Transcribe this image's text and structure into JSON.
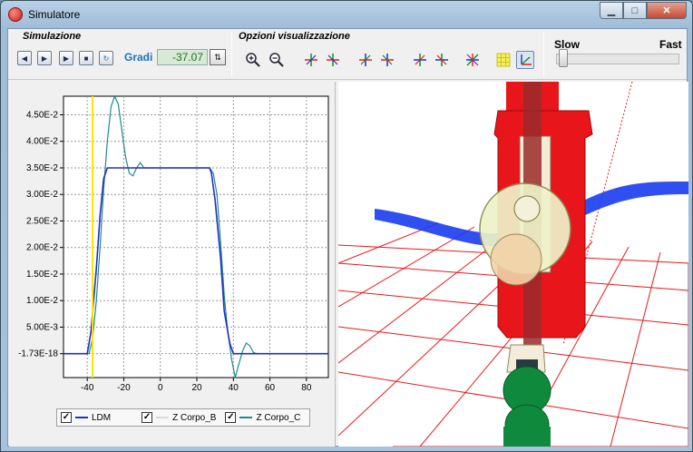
{
  "window": {
    "title": "Simulatore"
  },
  "toolbar": {
    "simulazione_label": "Simulazione",
    "opzioni_label": "Opzioni visualizzazione",
    "gradi_label": "Gradi",
    "gradi_value": "-37.07",
    "speed_slow": "Slow",
    "speed_fast": "Fast",
    "speed_value": 0.02
  },
  "chart_data": {
    "type": "line",
    "y_ticks": [
      "4.50E-2",
      "4.00E-2",
      "3.50E-2",
      "3.00E-2",
      "2.50E-2",
      "2.00E-2",
      "1.50E-2",
      "1.00E-2",
      "5.00E-3",
      "-1.73E-18"
    ],
    "x_ticks": [
      "-40",
      "-20",
      "0",
      "20",
      "40",
      "60",
      "80"
    ],
    "xlim": [
      -53,
      92
    ],
    "ylim": [
      -0.0045,
      0.0485
    ],
    "cursor_x": -37.07,
    "series": [
      {
        "name": "LDM",
        "color": "#2030c0",
        "x": [
          -53,
          -40,
          -38,
          -35,
          -33,
          -31,
          -29,
          -28,
          27,
          28,
          30,
          33,
          35,
          38,
          40,
          92
        ],
        "y": [
          0,
          0,
          0.004,
          0.016,
          0.026,
          0.033,
          0.035,
          0.035,
          0.035,
          0.034,
          0.029,
          0.018,
          0.008,
          0.002,
          0,
          0
        ]
      },
      {
        "name": "Z Corpo_B",
        "color": "#e8e8e8",
        "x": [
          -53,
          -40,
          -38,
          -35,
          -33,
          -31,
          -29,
          -28,
          27,
          28,
          30,
          33,
          35,
          38,
          40,
          92
        ],
        "y": [
          0,
          0,
          0.004,
          0.016,
          0.026,
          0.033,
          0.035,
          0.035,
          0.035,
          0.034,
          0.029,
          0.018,
          0.008,
          0.002,
          0,
          0
        ]
      },
      {
        "name": "Z Corpo_C",
        "color": "#1f8a8a",
        "x": [
          -53,
          -39,
          -37,
          -35,
          -33,
          -31,
          -29,
          -27,
          -25,
          -23,
          -21,
          -19,
          -17,
          -15,
          -13,
          -11,
          -9,
          27,
          29,
          31,
          33,
          35,
          37,
          39,
          41,
          43,
          45,
          47,
          49,
          51,
          53,
          55,
          92
        ],
        "y": [
          0,
          0,
          0.003,
          0.01,
          0.02,
          0.031,
          0.04,
          0.0465,
          0.0485,
          0.047,
          0.042,
          0.037,
          0.034,
          0.0335,
          0.035,
          0.036,
          0.035,
          0.035,
          0.034,
          0.03,
          0.021,
          0.011,
          0.004,
          -0.001,
          -0.0045,
          -0.002,
          0.0005,
          0.002,
          0.0015,
          0.0002,
          0,
          0,
          0
        ]
      }
    ]
  },
  "legend": [
    {
      "label": "LDM",
      "color": "#2030c0",
      "checked": "✓"
    },
    {
      "label": "Z Corpo_B",
      "color": "#e8e8e8",
      "checked": "✓"
    },
    {
      "label": "Z Corpo_C",
      "color": "#1f8a8a",
      "checked": "✓"
    }
  ]
}
